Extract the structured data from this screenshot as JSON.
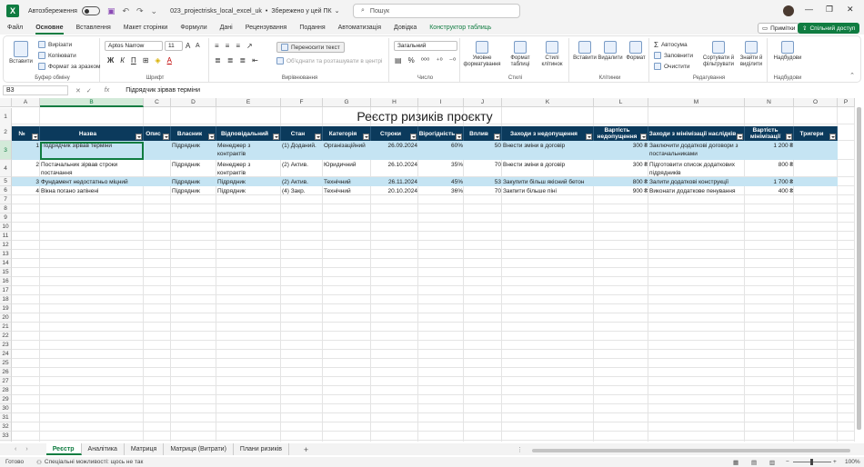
{
  "app": {
    "autosave_label": "Автозбереження",
    "file_title": "023_projectrisks_local_excel_uk",
    "save_status": "Збережено у цей ПК",
    "search_placeholder": "Пошук"
  },
  "menu": {
    "tabs": [
      "Файл",
      "Основне",
      "Вставлення",
      "Макет сторінки",
      "Формули",
      "Дані",
      "Рецензування",
      "Подання",
      "Автоматизація",
      "Довідка",
      "Конструктор таблиць"
    ],
    "notes": "Примітки",
    "share": "Спільний доступ"
  },
  "ribbon": {
    "clipboard": {
      "paste": "Вставити",
      "cut": "Вирізати",
      "copy": "Копіювати",
      "format_painter": "Формат за зразком",
      "label": "Буфер обміну"
    },
    "font": {
      "name": "Aptos Narrow",
      "size": "11",
      "label": "Шрифт"
    },
    "alignment": {
      "wrap": "Переносити текст",
      "merge": "Об'єднати та розташувати в центрі",
      "label": "Вирівнювання"
    },
    "number": {
      "format": "Загальний",
      "label": "Число"
    },
    "styles": {
      "conditional": "Умовне форматування",
      "as_table": "Формат таблиці",
      "cell_styles": "Стилі клітинок",
      "label": "Стилі"
    },
    "cells": {
      "insert": "Вставити",
      "delete": "Видалити",
      "format": "Формат",
      "label": "Клітинки"
    },
    "editing": {
      "autosum": "Автосума",
      "fill": "Заповнити",
      "clear": "Очистити",
      "sort": "Сортувати й фільтрувати",
      "find": "Знайти й виділити",
      "label": "Редагування"
    },
    "addins": {
      "button": "Надбудови",
      "label": "Надбудови"
    }
  },
  "formula": {
    "cell_ref": "B3",
    "fx": "fx",
    "content": "Підрядчик зірвав терміни"
  },
  "sheet": {
    "columns": [
      "A",
      "B",
      "C",
      "D",
      "E",
      "F",
      "G",
      "H",
      "I",
      "J",
      "K",
      "L",
      "M",
      "N",
      "O",
      "P"
    ],
    "rows": [
      "1",
      "2",
      "3",
      "4",
      "5",
      "6",
      "7",
      "8",
      "9",
      "10",
      "11",
      "12",
      "13",
      "14",
      "15",
      "16",
      "17",
      "18",
      "19",
      "20",
      "21",
      "22",
      "23",
      "24",
      "25",
      "26",
      "27",
      "28",
      "29",
      "30",
      "31",
      "32",
      "33",
      "34",
      "35",
      "36"
    ],
    "title": "Реєстр ризиків проєкту",
    "headers": [
      "№",
      "Назва",
      "Опис",
      "Власник",
      "Відповідальний",
      "Стан",
      "Категорія",
      "Строки",
      "Вірогідність",
      "Вплив",
      "Заходи з недопущення",
      "Вартість недопущення",
      "Заходи з мінімізації наслідків",
      "Вартість мінімізації",
      "Тригери"
    ],
    "data": [
      [
        "1",
        "Подрядчик зірвав терміни",
        "",
        "Підрядник",
        "Менеджер з контрактів",
        "(1) Доданий.",
        "Організаційний",
        "26.09.2024",
        "60%",
        "50",
        "Внести зміни в договір",
        "300 ₴",
        "Заключити додаткові договори з постачальниками",
        "1 200 ₴",
        ""
      ],
      [
        "2",
        "Постачальник зірвав строки постачання",
        "",
        "Підрядник",
        "Менеджер з контрактів",
        "(2) Актив.",
        "Юридичний",
        "26.10.2024",
        "35%",
        "70",
        "Внести зміни в договір",
        "300 ₴",
        "Підготовити список додаткових підрядників",
        "800 ₴",
        ""
      ],
      [
        "3",
        "Фундамент недостатньо міцний",
        "",
        "Підрядник",
        "Підрядник",
        "(2) Актив.",
        "Технічний",
        "26.11.2024",
        "45%",
        "53",
        "Закупити більш якісний бетон",
        "800 ₴",
        "Залити додаткові конструкції",
        "1 700 ₴",
        ""
      ],
      [
        "4",
        "Вікна погано запінені",
        "",
        "Підрядник",
        "Підрядник",
        "(4) Закр.",
        "Технічний",
        "20.10.2024",
        "36%",
        "70",
        "Закпити більше піні",
        "900 ₴",
        "Виконати додаткове пенування",
        "400 ₴",
        ""
      ]
    ]
  },
  "sheet_tabs": [
    "Реєстр",
    "Аналітика",
    "Матриця",
    "Матриця (Витрати)",
    "Плани ризиків"
  ],
  "status": {
    "ready": "Готово",
    "accessibility": "Спеціальні можливості: щось не так",
    "zoom": "100%"
  },
  "colors": {
    "accent": "#107c41",
    "header_fill": "#0b3a5c",
    "band": "#c5e4f3"
  }
}
